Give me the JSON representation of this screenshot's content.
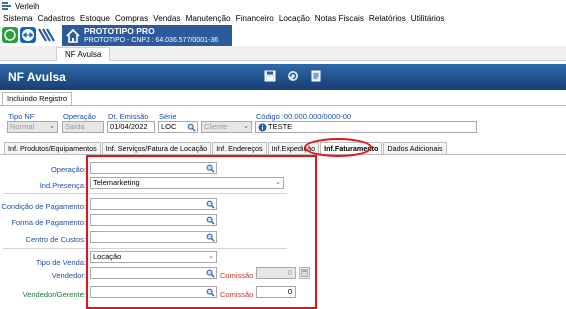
{
  "window": {
    "title": "Verleih"
  },
  "menu": [
    "Sistema",
    "Cadastros",
    "Estoque",
    "Compras",
    "Vendas",
    "Manutenção",
    "Financeiro",
    "Locação",
    "Notas Fiscais",
    "Relatórios",
    "Utilitários"
  ],
  "brand": {
    "name": "PROTOTIPO PRO",
    "cnpj": "PROTOTIPO - CNPJ : 64.036.577/0001-36"
  },
  "doc_tab": "NF Avulsa",
  "header": {
    "title": "NF Avulsa"
  },
  "subtab": "Incluindo Registro",
  "top_fields": {
    "tipo_nf": {
      "label": "Tipo NF",
      "value": "Normal"
    },
    "operacao": {
      "label": "Operação",
      "value": "Saída"
    },
    "dt_emissao": {
      "label": "Dt. Emissão",
      "value": "01/04/2022"
    },
    "serie": {
      "label": "Série",
      "value": "LOC"
    },
    "cliente": {
      "value": "Cliente"
    },
    "codigo": {
      "label": "Código :00.000.000/0000-00",
      "value": "TESTE"
    }
  },
  "tabs": [
    {
      "label": "Inf. Produtos/Equipamentos",
      "active": false
    },
    {
      "label": "Inf. Serviços/Fatura de Locação",
      "active": false
    },
    {
      "label": "Inf. Endereços",
      "active": false
    },
    {
      "label": "Inf.Expedição",
      "active": false
    },
    {
      "label": "Inf.Faturamento",
      "active": true
    },
    {
      "label": "Dados Adicionais",
      "active": false
    }
  ],
  "form": {
    "operacao": {
      "label": "Operação:",
      "value": ""
    },
    "ind_presenca": {
      "label": "Ind.Presença:",
      "value": "Telemarketing"
    },
    "condicao": {
      "label": "Condição de Pagamento:",
      "value": ""
    },
    "forma": {
      "label": "Forma de Pagamento:",
      "value": ""
    },
    "centro": {
      "label": "Centro de Custos:",
      "value": ""
    },
    "tipo_venda": {
      "label": "Tipo de Venda:",
      "value": "Locação"
    },
    "vendedor": {
      "label": "Vendedor:",
      "value": "",
      "comissao_label": "Comissão :",
      "comissao": "0"
    },
    "vendedor_gerente": {
      "label": "Vendedor/Gerente:",
      "value": "",
      "comissao_label": "Comissão :",
      "comissao": "0"
    }
  },
  "colors": {
    "header_top": "#2e6aa8",
    "header_bottom": "#173e73",
    "highlight": "#e0141b",
    "label_blue": "#1f4fa8",
    "label_red": "#c0392b",
    "label_green": "#1a7a3a"
  }
}
